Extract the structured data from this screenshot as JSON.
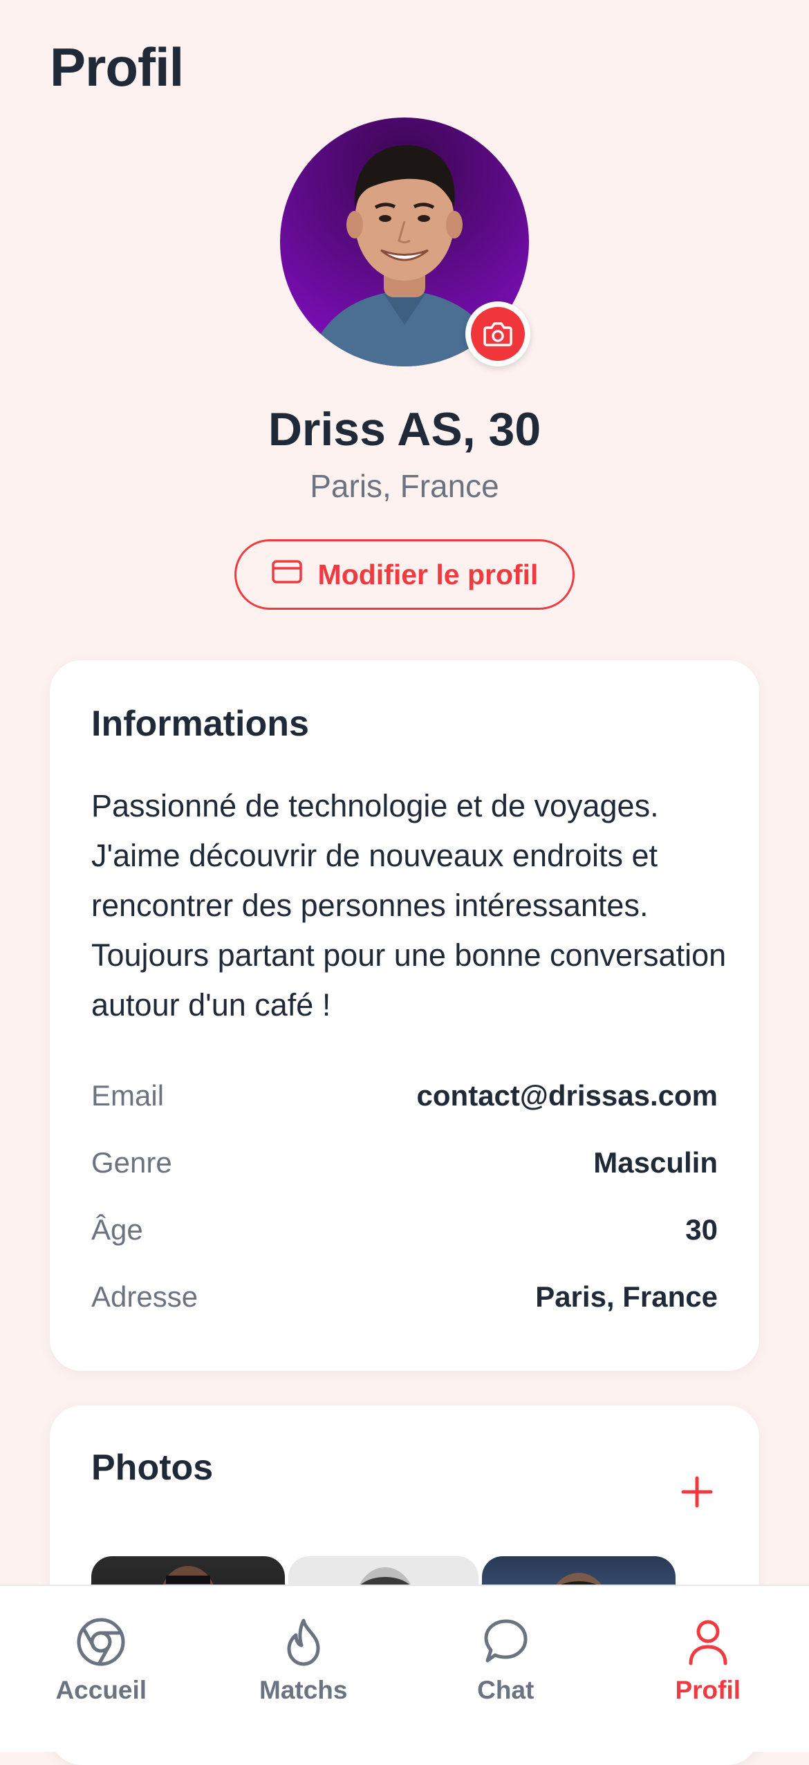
{
  "page": {
    "title": "Profil"
  },
  "profile": {
    "name": "Driss AS, 30",
    "location": "Paris, France",
    "edit_label": "Modifier le profil"
  },
  "info_card": {
    "title": "Informations",
    "bio": "Passionné de technologie et de voyages. J'aime découvrir de nouveaux endroits et rencontrer des personnes intéressantes. Toujours partant pour une bonne conversation autour d'un café !",
    "rows": [
      {
        "label": "Email",
        "value": "contact@drissas.com"
      },
      {
        "label": "Genre",
        "value": "Masculin"
      },
      {
        "label": "Âge",
        "value": "30"
      },
      {
        "label": "Adresse",
        "value": "Paris, France"
      }
    ]
  },
  "photos_card": {
    "title": "Photos"
  },
  "nav": {
    "items": [
      {
        "label": "Accueil",
        "icon": "chrome-icon",
        "active": false
      },
      {
        "label": "Matchs",
        "icon": "flame-icon",
        "active": false
      },
      {
        "label": "Chat",
        "icon": "chat-bubble-icon",
        "active": false
      },
      {
        "label": "Profil",
        "icon": "user-icon",
        "active": true
      }
    ]
  },
  "colors": {
    "accent": "#ef3b3f",
    "background": "#fdf2f0",
    "text": "#1f2937",
    "muted": "#6b7280"
  }
}
